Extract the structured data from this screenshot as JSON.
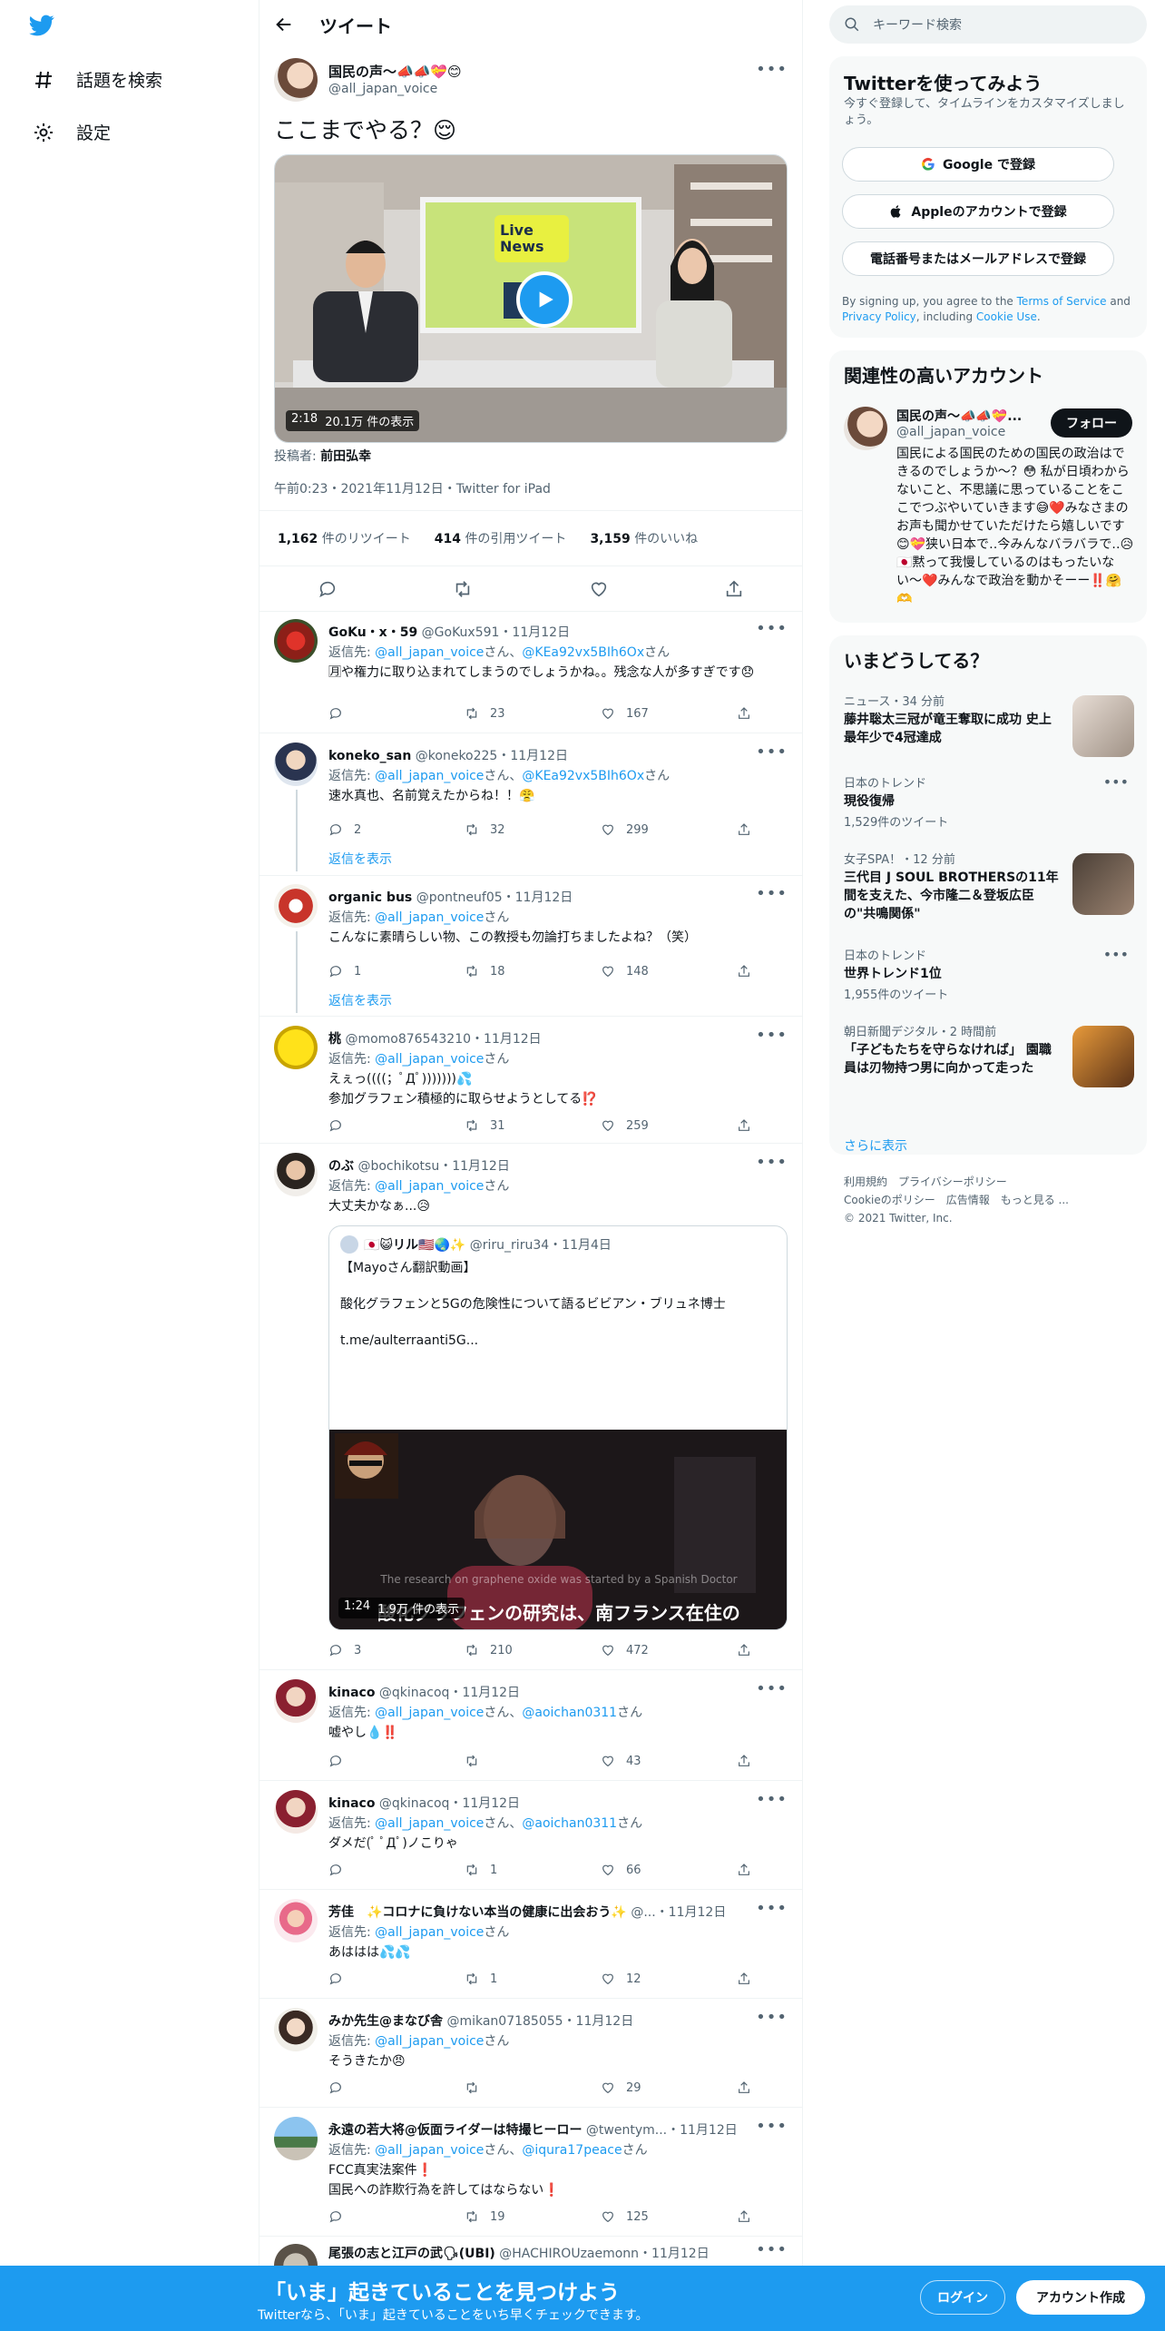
{
  "nav": {
    "explore_label": "話題を検索",
    "settings_label": "設定"
  },
  "header": {
    "title": "ツイート"
  },
  "main_tweet": {
    "name": "国民の声〜📣📣💝😊",
    "handle": "@all_japan_voice",
    "text": "ここまでやる？😌",
    "video_duration": "2:18",
    "video_views": "20.1万 件の表示",
    "video_caption": "Live News",
    "contributor_label": "投稿者:",
    "contributor_name": "前田弘幸",
    "meta": "午前0:23・2021年11月12日・Twitter for iPad",
    "retweets_count": "1,162",
    "retweets_label": "件のリツイート",
    "quotes_count": "414",
    "quotes_label": "件の引用ツイート",
    "likes_count": "3,159",
    "likes_label": "件のいいね"
  },
  "replies": [
    {
      "name": "GoKu・x・59",
      "handle": "@GoKux591",
      "date": "・11月12日",
      "to_prefix": "返信先: ",
      "to_1": "@all_japan_voice",
      "to_sep": "さん、",
      "to_2": "@KEa92vx5BIh6Ox",
      "to_suffix": "さん",
      "text": "🈷や権力に取り込まれてしまうのでしょうかね。。残念な人が多すぎです😞",
      "reply": "",
      "retweet": "23",
      "like": "167"
    },
    {
      "name": "koneko_san",
      "handle": "@koneko225",
      "date": "・11月12日",
      "to_prefix": "返信先: ",
      "to_1": "@all_japan_voice",
      "to_sep": "さん、",
      "to_2": "@KEa92vx5BIh6Ox",
      "to_suffix": "さん",
      "text": "速水真也、名前覚えたからね！！😤",
      "reply": "2",
      "retweet": "32",
      "like": "299",
      "show_replies": "返信を表示"
    },
    {
      "name": "organic bus",
      "handle": "@pontneuf05",
      "date": "・11月12日",
      "to_prefix": "返信先: ",
      "to_1": "@all_japan_voice",
      "to_suffix": "さん",
      "text": "こんなに素晴らしい物、この教授も勿論打ちましたよね？（笑）",
      "reply": "1",
      "retweet": "18",
      "like": "148",
      "show_replies": "返信を表示"
    },
    {
      "name": "桃",
      "handle": "@momo876543210",
      "date": "・11月12日",
      "to_prefix": "返信先: ",
      "to_1": "@all_japan_voice",
      "to_suffix": "さん",
      "text": "えぇっ((((；ﾟДﾟ)))))))💦\n参加グラフェン積極的に取らせようとしてる⁉️",
      "reply": "",
      "retweet": "31",
      "like": "259"
    },
    {
      "name": "のぶ",
      "handle": "@bochikotsu",
      "date": "・11月12日",
      "to_prefix": "返信先: ",
      "to_1": "@all_japan_voice",
      "to_suffix": "さん",
      "text": "大丈夫かなぁ...😥",
      "reply": "3",
      "retweet": "210",
      "like": "472",
      "quote": {
        "name": "🇯🇵😺リル🇺🇸🌏✨",
        "handle": "@riru_riru34",
        "date": "・11月4日",
        "text": "【Mayoさん翻訳動画】\n\n酸化グラフェンと5Gの危険性について語るビビアン・ブリュネ博士\n\nt.me/aulterraanti5G...",
        "video_duration": "1:24",
        "video_views": "1.9万 件の表示",
        "subtitle_en": "The research on graphene oxide was started by a Spanish Doctor",
        "subtitle_jp": "酸化グラフェンの研究は、南フランス在住の"
      }
    },
    {
      "name": "kinaco",
      "handle": "@qkinacoq",
      "date": "・11月12日",
      "to_prefix": "返信先: ",
      "to_1": "@all_japan_voice",
      "to_sep": "さん、",
      "to_2": "@aoichan0311",
      "to_suffix": "さん",
      "text": "嘘やし💧‼️",
      "reply": "",
      "retweet": "",
      "like": "43"
    },
    {
      "name": "kinaco",
      "handle": "@qkinacoq",
      "date": "・11月12日",
      "to_prefix": "返信先: ",
      "to_1": "@all_japan_voice",
      "to_sep": "さん、",
      "to_2": "@aoichan0311",
      "to_suffix": "さん",
      "text": "ダメだ(ﾟ ﾟДﾟ)ノこりゃ",
      "reply": "",
      "retweet": "1",
      "like": "66"
    },
    {
      "name": "芳佳　✨コロナに負けない本当の健康に出会おう✨",
      "handle": "@...",
      "date": "・11月12日",
      "to_prefix": "返信先: ",
      "to_1": "@all_japan_voice",
      "to_suffix": "さん",
      "text": "あははは💦💦",
      "reply": "",
      "retweet": "1",
      "like": "12"
    },
    {
      "name": "みか先生@まなび舎",
      "handle": "@mikan07185055",
      "date": "・11月12日",
      "to_prefix": "返信先: ",
      "to_1": "@all_japan_voice",
      "to_suffix": "さん",
      "text": "そうきたか😠",
      "reply": "",
      "retweet": "",
      "like": "29"
    },
    {
      "name": "永遠の若大将@仮面ライダーは特撮ヒーロー",
      "handle": "@twentym...",
      "date": "・11月12日",
      "to_prefix": "返信先: ",
      "to_1": "@all_japan_voice",
      "to_sep": "さん、",
      "to_2": "@iqura17peace",
      "to_suffix": "さん",
      "text": "FCC真実法案件❗️\n国民への詐欺行為を許してはならない❗️",
      "reply": "",
      "retweet": "19",
      "like": "125"
    },
    {
      "name": "尾張の志と江戸の武🗣(UBI)",
      "handle": "@HACHIROUzaemonn",
      "date": "・11月12日"
    }
  ],
  "search": {
    "placeholder": "キーワード検索"
  },
  "signup_card": {
    "title": "Twitterを使ってみよう",
    "subtitle": "今すぐ登録して、タイムラインをカスタマイズしましょう。",
    "google": "Google で登録",
    "apple": "Appleのアカウントで登録",
    "phone": "電話番号またはメールアドレスで登録",
    "terms_1": "By signing up, you agree to the ",
    "terms_link_1": "Terms of Service",
    "terms_2": " and ",
    "terms_link_2": "Privacy Policy",
    "terms_3": ", including ",
    "terms_link_3": "Cookie Use",
    "terms_4": "."
  },
  "related_card": {
    "title": "関連性の高いアカウント",
    "name": "国民の声〜📣📣💝...",
    "handle": "@all_japan_voice",
    "follow": "フォロー",
    "bio": "国民による国民のための国民の政治はできるのでしょうか〜？😳 私が日頃わからないこと、不思議に思っていることをここでつぶやいていきます😅❤️みなさまのお声も聞かせていただけたら嬉しいです😊💝狭い日本で‥今みんなバラバラで‥😥🇯🇵黙って我慢しているのはもったいない〜❤️みんなで政治を動かそーー‼️🤗🫶"
  },
  "trends_card": {
    "title": "いまどうしてる？",
    "items": [
      {
        "meta": "ニュース・34 分前",
        "title": "藤井聡太三冠が竜王奪取に成功 史上最年少で4冠達成",
        "count": ""
      },
      {
        "meta": "日本のトレンド",
        "title": "現役復帰",
        "count": "1,529件のツイート"
      },
      {
        "meta": "女子SPA！・12 分前",
        "title": "三代目 J SOUL BROTHERSの11年間を支えた、今市隆二＆登坂広臣の\"共鳴関係\"",
        "count": ""
      },
      {
        "meta": "日本のトレンド",
        "title": "世界トレンド1位",
        "count": "1,955件のツイート"
      },
      {
        "meta": "朝日新聞デジタル・2 時間前",
        "title": "「子どもたちを守らなければ」 園職員は刃物持つ男に向かって走った",
        "count": ""
      }
    ],
    "more": "さらに表示"
  },
  "footer": {
    "line1": "利用規約　プライバシーポリシー",
    "line2": "Cookieのポリシー　広告情報　もっと見る ...",
    "line3": "© 2021 Twitter, Inc."
  },
  "bottom_bar": {
    "title": "「いま」起きていることを見つけよう",
    "subtitle": "Twitterなら、「いま」起きていることをいち早くチェックできます。",
    "login": "ログイン",
    "signup": "アカウント作成"
  },
  "colors": {
    "accent": "#1d9bf0",
    "text": "#0f1419",
    "secondary": "#536471"
  }
}
